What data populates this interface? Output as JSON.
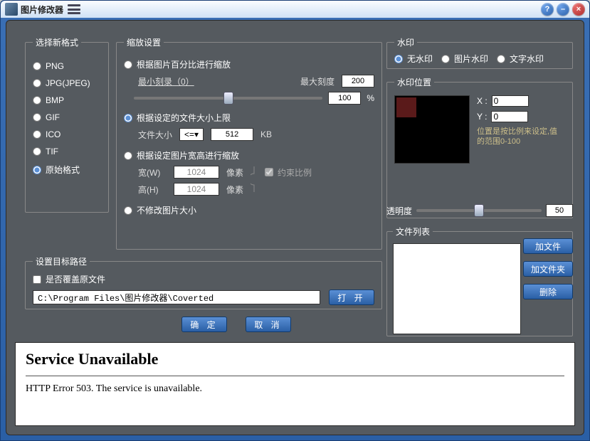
{
  "title": "图片修改器",
  "format": {
    "legend": "选择新格式",
    "options": [
      "PNG",
      "JPG(JPEG)",
      "BMP",
      "GIF",
      "ICO",
      "TIF",
      "原始格式"
    ],
    "selected": "原始格式"
  },
  "scale": {
    "legend": "缩放设置",
    "opt_percent": "根据图片百分比进行缩放",
    "min_scale_label": "最小刻录（0）",
    "max_scale_label": "最大刻度",
    "max_scale_value": "200",
    "percent_value": "100",
    "percent_suffix": "%",
    "opt_filesize": "根据设定的文件大小上限",
    "filesize_label": "文件大小",
    "filesize_btn": "<=",
    "filesize_value": "512",
    "filesize_unit": "KB",
    "opt_wh": "根据设定图片宽高进行缩放",
    "w_label": "宽(W)",
    "h_label": "高(H)",
    "w_value": "1024",
    "h_value": "1024",
    "px_unit": "像素",
    "constrain": "约束比例",
    "opt_none": "不修改图片大小",
    "selected": "opt_filesize"
  },
  "watermark": {
    "legend": "水印",
    "options": [
      "无水印",
      "图片水印",
      "文字水印"
    ],
    "selected": "无水印"
  },
  "wmpos": {
    "legend": "水印位置",
    "x_label": "X :",
    "y_label": "Y :",
    "x_value": "0",
    "y_value": "0",
    "note": "位置是按比例来设定,值的范围0-100"
  },
  "opacity": {
    "label": "透明度",
    "value": "50"
  },
  "path": {
    "legend": "设置目标路径",
    "overwrite": "是否覆盖原文件",
    "value": "C:\\Program Files\\图片修改器\\Coverted",
    "open": "打  开"
  },
  "buttons": {
    "ok": "确  定",
    "cancel": "取  消",
    "add_file": "加文件",
    "add_folder": "加文件夹",
    "delete": "删除"
  },
  "files": {
    "legend": "文件列表"
  },
  "bottom": {
    "h": "Service Unavailable",
    "p": "HTTP Error 503. The service is unavailable."
  }
}
